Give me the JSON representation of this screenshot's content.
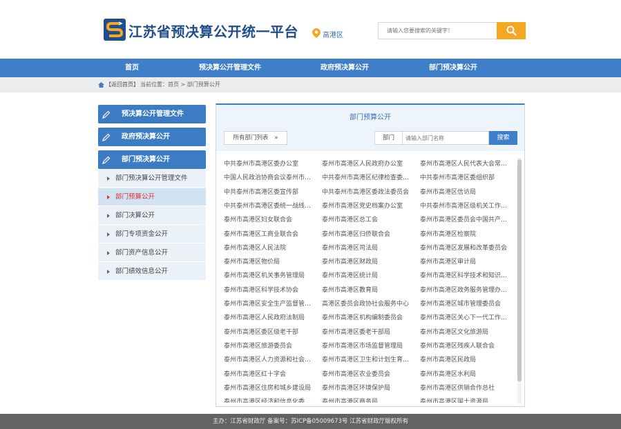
{
  "header": {
    "site_title": "江苏省预决算公开统一平台",
    "location": "高港区",
    "search_placeholder": "请输入您要搜索的关键字！"
  },
  "nav": {
    "items": [
      {
        "label": "首页"
      },
      {
        "label": "预决算公开管理文件"
      },
      {
        "label": "政府预决算公开"
      },
      {
        "label": "部门预决算公开"
      }
    ]
  },
  "breadcrumb": {
    "back": "【返回首页】",
    "position": "当前位置：首页 > 部门预算公开"
  },
  "sidebar": {
    "main_items": [
      {
        "label": "预决算公开管理文件"
      },
      {
        "label": "政府预决算公开"
      },
      {
        "label": "部门预决算公开"
      }
    ],
    "sub_items": [
      {
        "label": "部门预决算公开管理文件"
      },
      {
        "label": "部门预算公开"
      },
      {
        "label": "部门决算公开"
      },
      {
        "label": "部门专项资金公开"
      },
      {
        "label": "部门资产信息公开"
      },
      {
        "label": "部门绩效信息公开"
      }
    ],
    "active_sub": "部门预算公开"
  },
  "panel": {
    "title": "部门预算公开",
    "filter_label": "所有部门列表",
    "dept_label": "部门",
    "dept_placeholder": "请输入部门名称",
    "search_button": "搜索"
  },
  "departments": [
    [
      "中共泰州市高港区委办公室",
      "泰州市高港区人民政府办公室",
      "泰州市高港区人民代表大会常务委员会办公室"
    ],
    [
      "中国人民政治协商会议泰州市高港区委员会",
      "中共泰州市高港区纪律检查委员会",
      "中共泰州市高港区委组织部"
    ],
    [
      "中共泰州市高港区委宣传部",
      "中共泰州市高港区委政法委员会",
      "泰州市高港区信访局"
    ],
    [
      "中共泰州市高港区委统一战线工作部",
      "泰州市高港区党史档案办公室",
      "中共泰州市高港区级机关工作委员会"
    ],
    [
      "泰州市高港区妇女联合会",
      "泰州市高港区总工会",
      "泰州市高港区委员会中国共产主义青年团"
    ],
    [
      "泰州市高港区工商业联合会",
      "泰州市高港区归侨联合会",
      "泰州市高港区检察院"
    ],
    [
      "泰州市高港区人民法院",
      "泰州市高港区司法局",
      "泰州市高港区发展和改革委员会"
    ],
    [
      "泰州市高港区物价局",
      "泰州市高港区财政局",
      "泰州市高港区审计局"
    ],
    [
      "泰州市高港区机关事务管理局",
      "泰州市高港区统计局",
      "泰州市高港区科学技术和知识产权局"
    ],
    [
      "泰州市高港区科学技术协会",
      "泰州市高港区教育局",
      "泰州市高港区政务服务管理办公室"
    ],
    [
      "泰州市高港区安全生产监督管理局",
      "高港区委员会政协社会服务中心",
      "泰州市高港区城市管理委员会"
    ],
    [
      "泰州市高港区人民政府法制局",
      "泰州市高港区机构编制委员会",
      "泰州市高港区关心下一代工作委员会"
    ],
    [
      "泰州市高港区委区级老干部",
      "泰州市高港区委老干部局",
      "泰州市高港区文化旅游局"
    ],
    [
      "泰州市高港区旅游委员会",
      "泰州市高港区市场监督管理局",
      "泰州市高港区残疾人联合会"
    ],
    [
      "泰州市高港区人力资源和社会保障局",
      "泰州市高港区卫生和计划生育委员会",
      "泰州市高港区民政局"
    ],
    [
      "泰州市高港区红十字会",
      "泰州市高港区农业委员会",
      "泰州市高港区水利局"
    ],
    [
      "泰州市高港区住房和城乡建设局",
      "泰州市高港区环境保护局",
      "泰州市高港区供销合作总社"
    ],
    [
      "泰州市高港区经济和信息化委员会",
      "泰州市高港区商务局",
      "泰州市高港区国土资源局"
    ]
  ],
  "footer": {
    "text": "主办：江苏省财政厅 备案号：苏ICP备05009673号 江苏省财政厅版权所有"
  },
  "colors": {
    "brand_blue": "#3f7ec8",
    "accent_orange": "#f5a623",
    "title_blue": "#1f4e8a",
    "active_red": "#e03030"
  }
}
